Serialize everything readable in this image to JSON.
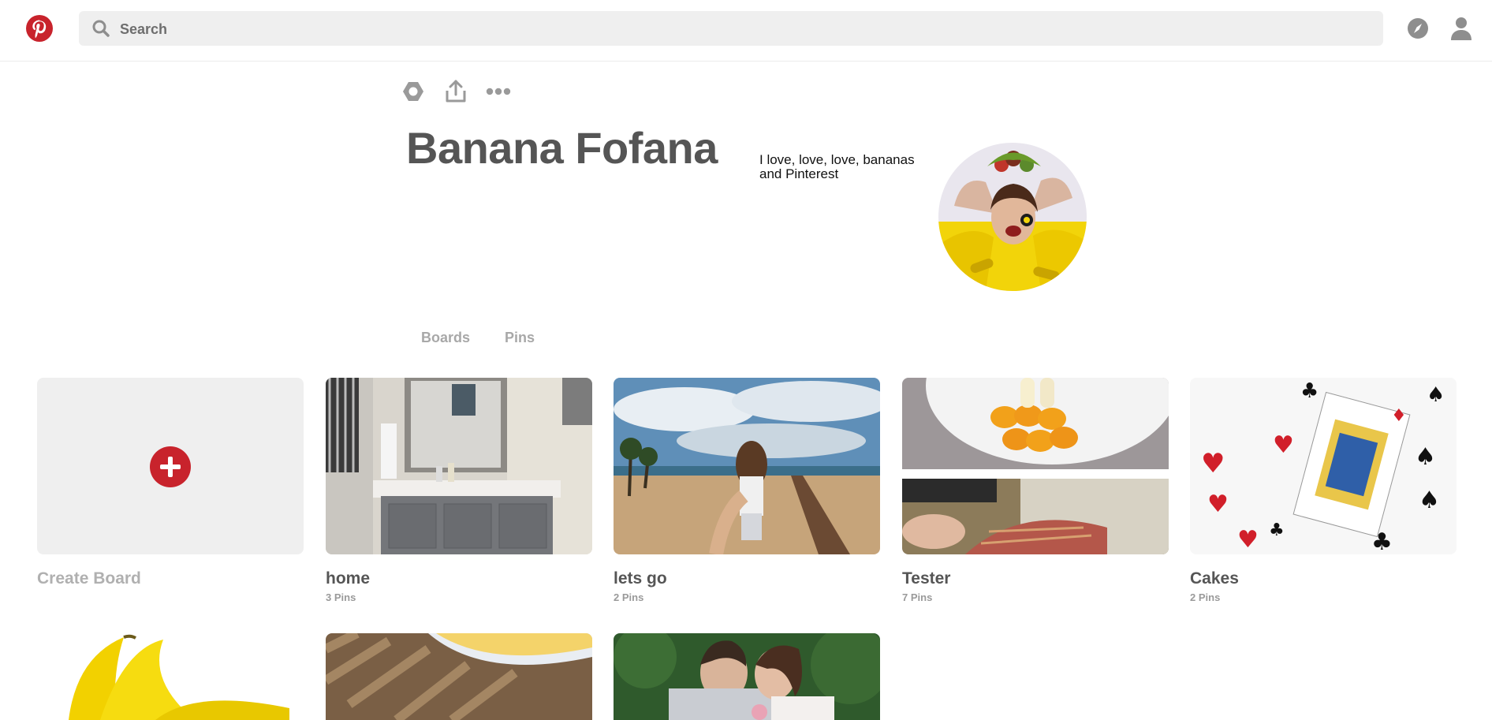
{
  "header": {
    "search_placeholder": "Search"
  },
  "profile": {
    "name": "Banana Fofana",
    "bio": "I love, love, love, bananas and Pinterest"
  },
  "tabs": [
    {
      "label": "Boards"
    },
    {
      "label": "Pins"
    }
  ],
  "boards": {
    "create_label": "Create Board",
    "items": [
      {
        "title": "home",
        "count": "3 Pins"
      },
      {
        "title": "lets go",
        "count": "2 Pins"
      },
      {
        "title": "Tester",
        "count": "7 Pins"
      },
      {
        "title": "Cakes",
        "count": "2 Pins"
      }
    ]
  },
  "colors": {
    "brand_red": "#c8232c",
    "search_bg": "#efefef",
    "muted_text": "#a8a8a8",
    "title_text": "#555555"
  },
  "icons": {
    "logo": "pinterest-logo",
    "search": "search-icon",
    "compass": "compass-icon",
    "user": "user-icon",
    "settings": "hexagon-settings-icon",
    "share": "share-icon",
    "more": "ellipsis-icon",
    "add": "plus-icon"
  }
}
